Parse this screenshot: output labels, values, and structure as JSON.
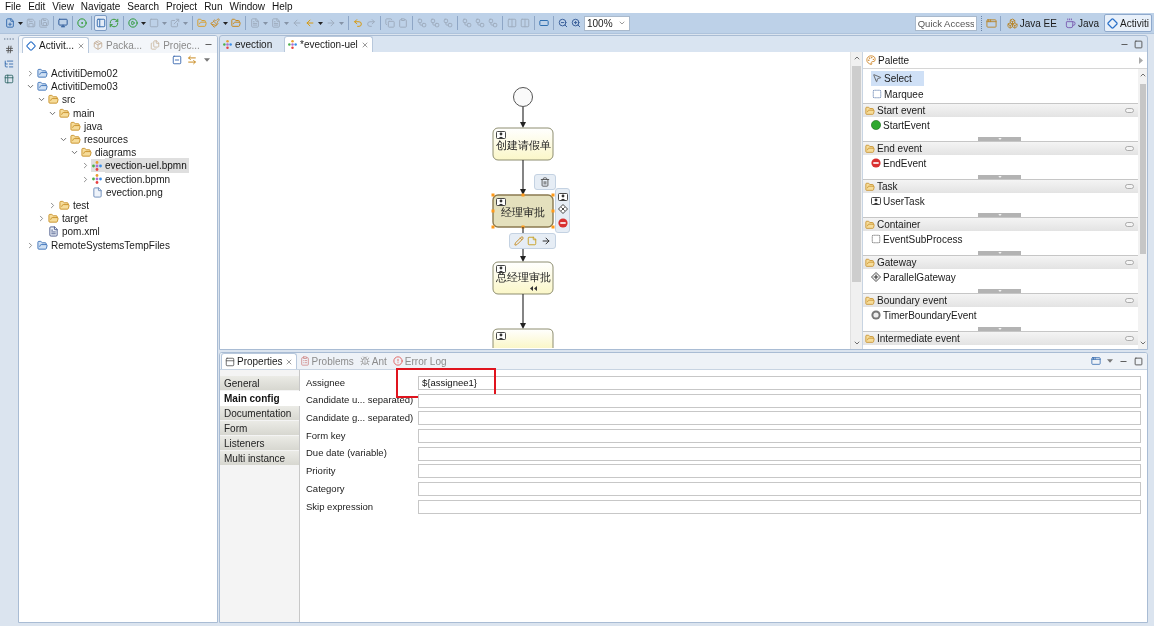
{
  "menu": [
    "File",
    "Edit",
    "View",
    "Navigate",
    "Search",
    "Project",
    "Run",
    "Window",
    "Help"
  ],
  "toolbar": {
    "groups": [
      [
        {
          "kind": "new",
          "dropdown": true,
          "disabled": false,
          "pressed": false
        },
        {
          "kind": "save",
          "dropdown": false,
          "disabled": true,
          "pressed": false
        },
        {
          "kind": "save_all",
          "dropdown": false,
          "disabled": true,
          "pressed": false
        }
      ],
      [
        {
          "kind": "terminal",
          "dropdown": false,
          "disabled": false,
          "pressed": false
        }
      ],
      [
        {
          "kind": "check",
          "dropdown": false,
          "disabled": false,
          "pressed": false
        }
      ],
      [
        {
          "kind": "panel",
          "dropdown": false,
          "disabled": false,
          "pressed": true
        },
        {
          "kind": "refresh",
          "dropdown": false,
          "disabled": false,
          "pressed": false
        }
      ],
      [
        {
          "kind": "debug",
          "dropdown": true,
          "disabled": false,
          "pressed": false
        },
        {
          "kind": "stop",
          "dropdown": true,
          "disabled": true,
          "pressed": false
        },
        {
          "kind": "launch",
          "dropdown": true,
          "disabled": true,
          "pressed": false
        }
      ],
      [
        {
          "kind": "open_folder",
          "dropdown": false,
          "disabled": false,
          "pressed": false
        },
        {
          "kind": "brush",
          "dropdown": true,
          "disabled": false,
          "pressed": false
        },
        {
          "kind": "folder",
          "dropdown": false,
          "disabled": false,
          "pressed": false
        }
      ],
      [
        {
          "kind": "doc",
          "dropdown": true,
          "disabled": true,
          "pressed": false
        },
        {
          "kind": "doc",
          "dropdown": true,
          "disabled": true,
          "pressed": false
        },
        {
          "kind": "back",
          "dropdown": false,
          "disabled": true,
          "pressed": false
        },
        {
          "kind": "back",
          "dropdown": true,
          "disabled": false,
          "pressed": false
        },
        {
          "kind": "forward",
          "dropdown": true,
          "disabled": true,
          "pressed": false
        }
      ],
      [
        {
          "kind": "undo",
          "dropdown": false,
          "disabled": false,
          "pressed": false
        },
        {
          "kind": "redo",
          "dropdown": false,
          "disabled": true,
          "pressed": false
        }
      ],
      [
        {
          "kind": "copy",
          "dropdown": false,
          "disabled": true,
          "pressed": false
        },
        {
          "kind": "paste",
          "dropdown": false,
          "disabled": true,
          "pressed": false
        }
      ],
      [
        {
          "kind": "align",
          "dropdown": false,
          "disabled": true,
          "pressed": false
        },
        {
          "kind": "align",
          "dropdown": false,
          "disabled": true,
          "pressed": false
        },
        {
          "kind": "align",
          "dropdown": false,
          "disabled": true,
          "pressed": false
        }
      ],
      [
        {
          "kind": "align",
          "dropdown": false,
          "disabled": true,
          "pressed": false
        },
        {
          "kind": "align",
          "dropdown": false,
          "disabled": true,
          "pressed": false
        },
        {
          "kind": "align",
          "dropdown": false,
          "disabled": true,
          "pressed": false
        }
      ],
      [
        {
          "kind": "layout",
          "dropdown": false,
          "disabled": true,
          "pressed": false
        },
        {
          "kind": "layout",
          "dropdown": false,
          "disabled": true,
          "pressed": false
        }
      ],
      [
        {
          "kind": "frame",
          "dropdown": false,
          "disabled": false,
          "pressed": false
        }
      ],
      [
        {
          "kind": "zoom_out",
          "dropdown": false,
          "disabled": false,
          "pressed": false
        },
        {
          "kind": "zoom_in",
          "dropdown": false,
          "disabled": false,
          "pressed": false
        }
      ]
    ],
    "zoom": {
      "value": "100%"
    },
    "quick_access": {
      "placeholder": "Quick Access"
    },
    "perspectives": [
      {
        "kind": "java_ee",
        "label": "Java EE",
        "selected": false
      },
      {
        "kind": "java",
        "label": "Java",
        "selected": false
      },
      {
        "kind": "activiti",
        "label": "Activiti",
        "selected": true
      }
    ]
  },
  "explorer": {
    "tabs": [
      {
        "kind": "activiti",
        "label": "Activit...",
        "selected": true
      },
      {
        "kind": "package",
        "label": "Packa...",
        "selected": false
      },
      {
        "kind": "project",
        "label": "Projec...",
        "selected": false
      }
    ],
    "tree": [
      {
        "label": "ActivitiDemo02",
        "kind": "project",
        "expanded": false,
        "selected": false
      },
      {
        "label": "ActivitiDemo03",
        "kind": "project",
        "expanded": true,
        "selected": false,
        "children": [
          {
            "label": "src",
            "kind": "folder",
            "expanded": true,
            "selected": false,
            "children": [
              {
                "label": "main",
                "kind": "folder",
                "expanded": true,
                "selected": false,
                "children": [
                  {
                    "label": "java",
                    "kind": "folder",
                    "selected": false
                  },
                  {
                    "label": "resources",
                    "kind": "folder",
                    "expanded": true,
                    "selected": false,
                    "children": [
                      {
                        "label": "diagrams",
                        "kind": "folder",
                        "expanded": true,
                        "selected": false,
                        "children": [
                          {
                            "label": "evection-uel.bpmn",
                            "kind": "bpmn",
                            "expanded": false,
                            "selected": true
                          },
                          {
                            "label": "evection.bpmn",
                            "kind": "bpmn",
                            "expanded": false,
                            "selected": false
                          },
                          {
                            "label": "evection.png",
                            "kind": "image",
                            "selected": false
                          }
                        ]
                      }
                    ]
                  }
                ]
              },
              {
                "label": "test",
                "kind": "folder",
                "expanded": false,
                "selected": false
              }
            ]
          },
          {
            "label": "target",
            "kind": "folder",
            "expanded": false,
            "selected": false
          },
          {
            "label": "pom.xml",
            "kind": "xml",
            "selected": false
          }
        ]
      },
      {
        "label": "RemoteSystemsTempFiles",
        "kind": "project",
        "expanded": false,
        "selected": false
      }
    ]
  },
  "editor": {
    "tabs": [
      {
        "label": "evection",
        "selected": false
      },
      {
        "label": "*evection-uel",
        "selected": true
      }
    ],
    "diagram": {
      "nodes": [
        {
          "kind": "start_event",
          "selected": false
        },
        {
          "kind": "user_task",
          "label": "创建请假单",
          "selected": false,
          "overflow_marker": false
        },
        {
          "kind": "user_task",
          "label": "经理审批",
          "selected": true,
          "overflow_marker": false
        },
        {
          "kind": "user_task",
          "label": "总经理审批",
          "selected": false,
          "overflow_marker": true
        },
        {
          "kind": "user_task",
          "selected": false,
          "overflow_marker": false
        }
      ]
    }
  },
  "palette": {
    "title": "Palette",
    "tools": [
      {
        "kind": "select",
        "label": "Select",
        "selected": true
      },
      {
        "kind": "marquee",
        "label": "Marquee",
        "selected": false
      }
    ],
    "drawers": [
      {
        "label": "Start event",
        "items": [
          {
            "kind": "start_event",
            "label": "StartEvent"
          }
        ]
      },
      {
        "label": "End event",
        "items": [
          {
            "kind": "end_event",
            "label": "EndEvent"
          }
        ]
      },
      {
        "label": "Task",
        "items": [
          {
            "kind": "user_task",
            "label": "UserTask"
          }
        ]
      },
      {
        "label": "Container",
        "items": [
          {
            "kind": "event_subprocess",
            "label": "EventSubProcess"
          }
        ]
      },
      {
        "label": "Gateway",
        "items": [
          {
            "kind": "parallel_gateway",
            "label": "ParallelGateway"
          }
        ]
      },
      {
        "label": "Boundary event",
        "items": [
          {
            "kind": "timer_boundary_event",
            "label": "TimerBoundaryEvent"
          }
        ]
      },
      {
        "label": "Intermediate event"
      }
    ]
  },
  "properties": {
    "tabs": [
      {
        "kind": "properties",
        "label": "Properties",
        "selected": true
      },
      {
        "kind": "problems",
        "label": "Problems",
        "selected": false
      },
      {
        "kind": "ant",
        "label": "Ant",
        "selected": false
      },
      {
        "kind": "error_log",
        "label": "Error Log",
        "selected": false
      }
    ],
    "sections": [
      {
        "label": "General",
        "selected": false
      },
      {
        "label": "Main config",
        "selected": true
      },
      {
        "label": "Documentation",
        "selected": false
      },
      {
        "label": "Form",
        "selected": false
      },
      {
        "label": "Listeners",
        "selected": false
      },
      {
        "label": "Multi instance",
        "selected": false
      }
    ],
    "fields": [
      {
        "label": "Assignee",
        "value": "${assignee1}",
        "highlighted": true
      },
      {
        "label": "Candidate u... separated)",
        "highlighted": false
      },
      {
        "label": "Candidate g... separated)",
        "highlighted": false
      },
      {
        "label": "Form key",
        "highlighted": false
      },
      {
        "label": "Due date (variable)",
        "highlighted": false
      },
      {
        "label": "Priority",
        "highlighted": false
      },
      {
        "label": "Category",
        "highlighted": false
      },
      {
        "label": "Skip expression",
        "highlighted": false
      }
    ]
  }
}
